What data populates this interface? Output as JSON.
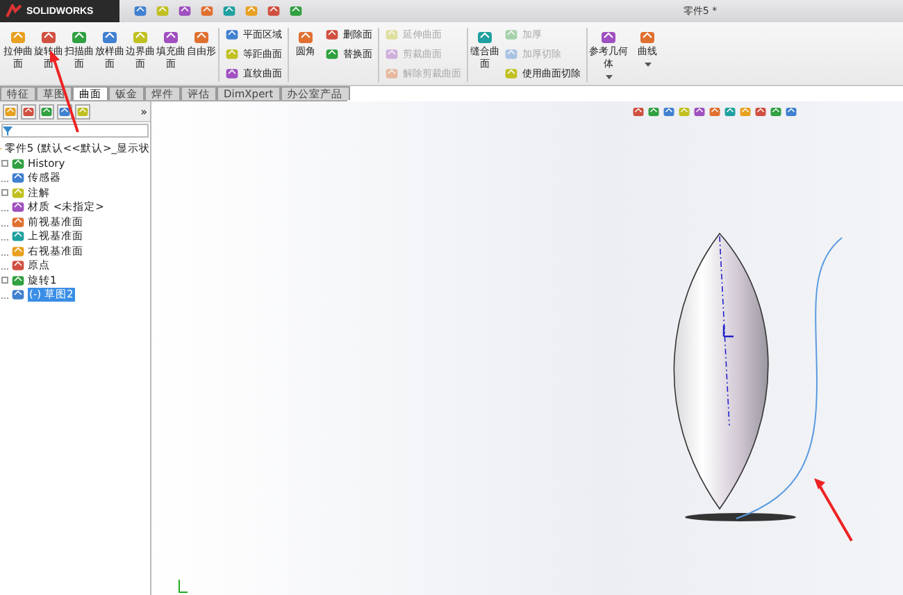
{
  "window": {
    "app_name": "SOLIDWORKS",
    "title": "零件5 *"
  },
  "ribbon": {
    "groups": [
      {
        "kind": "large",
        "buttons": [
          {
            "label": "拉伸曲面",
            "disabled": false
          },
          {
            "label": "旋转曲面",
            "disabled": false
          },
          {
            "label": "扫描曲面",
            "disabled": false
          },
          {
            "label": "放样曲面",
            "disabled": false
          },
          {
            "label": "边界曲面",
            "disabled": false
          },
          {
            "label": "填充曲面",
            "disabled": false
          },
          {
            "label": "自由形",
            "disabled": false
          }
        ]
      },
      {
        "kind": "small",
        "buttons": [
          {
            "label": "平面区域",
            "disabled": false
          },
          {
            "label": "等距曲面",
            "disabled": false
          },
          {
            "label": "直纹曲面",
            "disabled": false
          }
        ]
      },
      {
        "kind": "large",
        "buttons": [
          {
            "label": "圆角",
            "disabled": false
          }
        ]
      },
      {
        "kind": "small",
        "buttons": [
          {
            "label": "删除面",
            "disabled": false
          },
          {
            "label": "替换面",
            "disabled": false
          }
        ]
      },
      {
        "kind": "small",
        "buttons": [
          {
            "label": "延伸曲面",
            "disabled": true
          },
          {
            "label": "剪裁曲面",
            "disabled": true
          },
          {
            "label": "解除剪裁曲面",
            "disabled": true
          }
        ]
      },
      {
        "kind": "large",
        "buttons": [
          {
            "label": "缝合曲面",
            "disabled": false
          }
        ]
      },
      {
        "kind": "small",
        "buttons": [
          {
            "label": "加厚",
            "disabled": true
          },
          {
            "label": "加厚切除",
            "disabled": true
          },
          {
            "label": "使用曲面切除",
            "disabled": false
          }
        ]
      },
      {
        "kind": "dropdown",
        "buttons": [
          {
            "label": "参考几何体",
            "disabled": false
          },
          {
            "label": "曲线",
            "disabled": false
          }
        ]
      }
    ]
  },
  "tabs": [
    {
      "label": "特征",
      "selected": false
    },
    {
      "label": "草图",
      "selected": false
    },
    {
      "label": "曲面",
      "selected": true
    },
    {
      "label": "钣金",
      "selected": false
    },
    {
      "label": "焊件",
      "selected": false
    },
    {
      "label": "评估",
      "selected": false
    },
    {
      "label": "DimXpert",
      "selected": false
    },
    {
      "label": "办公室产品",
      "selected": false
    }
  ],
  "feature_tree": {
    "root": {
      "label": "零件5 (默认<<默认>_显示状",
      "children": [
        {
          "label": "History",
          "collapsed": true,
          "selected": false
        },
        {
          "label": "传感器",
          "collapsed": false,
          "selected": false
        },
        {
          "label": "注解",
          "collapsed": true,
          "selected": false
        },
        {
          "label": "材质 <未指定>",
          "collapsed": false,
          "selected": false
        },
        {
          "label": "前视基准面",
          "collapsed": false,
          "selected": false
        },
        {
          "label": "上视基准面",
          "collapsed": false,
          "selected": false
        },
        {
          "label": "右视基准面",
          "collapsed": false,
          "selected": false
        },
        {
          "label": "原点",
          "collapsed": false,
          "selected": false
        },
        {
          "label": "旋转1",
          "collapsed": true,
          "selected": false
        },
        {
          "label": "(-) 草图2",
          "collapsed": false,
          "selected": true
        }
      ]
    }
  },
  "panel_toolbar": {
    "expand": "»"
  }
}
